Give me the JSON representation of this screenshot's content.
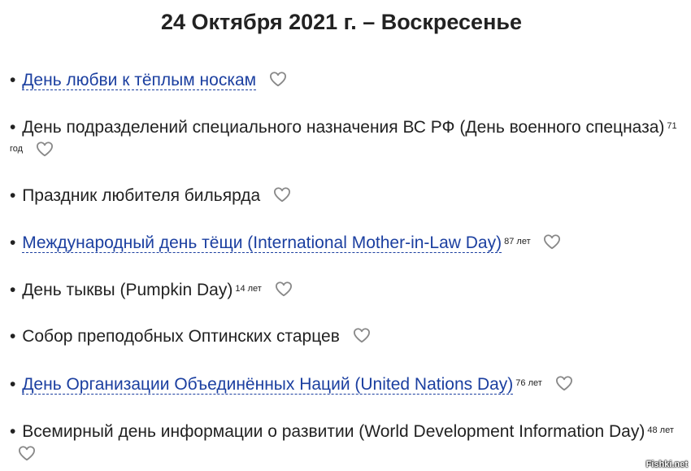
{
  "title": "24 Октября 2021 г. – Воскресенье",
  "bullet": "•",
  "items": [
    {
      "text": "День любви к тёплым носкам",
      "link": true,
      "age": ""
    },
    {
      "text": "День подразделений специального назначения ВС РФ (День военного спецназа)",
      "link": false,
      "age": "71 год"
    },
    {
      "text": "Праздник любителя бильярда",
      "link": false,
      "age": ""
    },
    {
      "text": "Международный день тёщи (International Mother-in-Law Day)",
      "link": true,
      "age": "87 лет"
    },
    {
      "text": "День тыквы (Pumpkin Day)",
      "link": false,
      "age": "14 лет"
    },
    {
      "text": "Собор преподобных Оптинских старцев",
      "link": false,
      "age": ""
    },
    {
      "text": "День Организации Объединённых Наций (United Nations Day)",
      "link": true,
      "age": "76 лет"
    },
    {
      "text": "Всемирный день информации о развитии (World Development Information Day)",
      "link": false,
      "age": "48 лет"
    }
  ],
  "heart_icon": "heart-outline-icon",
  "watermark": "Fishki.net",
  "colors": {
    "link": "#1b3fa0",
    "text": "#222222",
    "heart": "#888888"
  }
}
